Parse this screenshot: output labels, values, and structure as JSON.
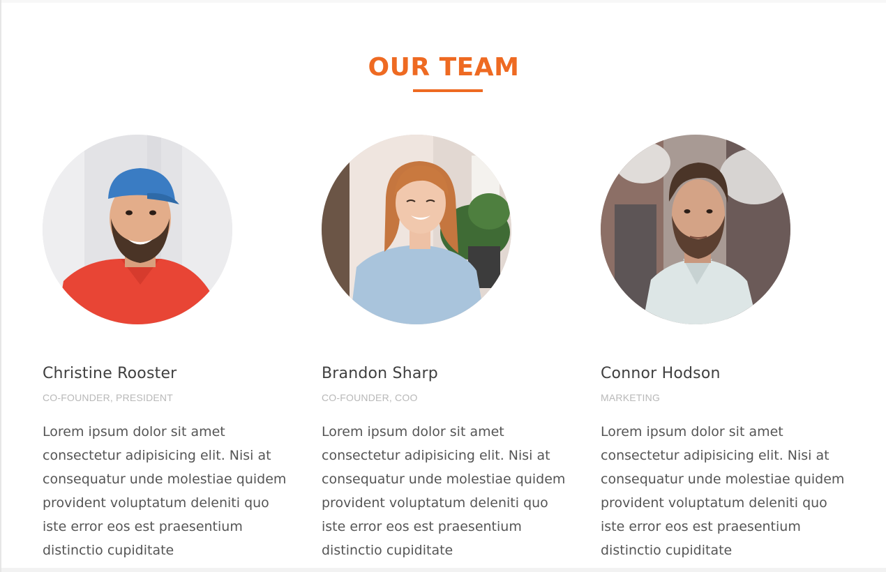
{
  "section": {
    "title": "OUR TEAM",
    "accent_color": "#ee6a22"
  },
  "members": [
    {
      "name": "Christine Rooster",
      "role": "CO-FOUNDER, PRESIDENT",
      "bio": "Lorem ipsum dolor sit amet consectetur adipisicing elit. Nisi at consequatur unde molestiae quidem provident voluptatum deleniti quo iste error eos est praesentium distinctio cupiditate"
    },
    {
      "name": "Brandon Sharp",
      "role": "CO-FOUNDER, COO",
      "bio": "Lorem ipsum dolor sit amet consectetur adipisicing elit. Nisi at consequatur unde molestiae quidem provident voluptatum deleniti quo iste error eos est praesentium distinctio cupiditate"
    },
    {
      "name": "Connor Hodson",
      "role": "MARKETING",
      "bio": "Lorem ipsum dolor sit amet consectetur adipisicing elit. Nisi at consequatur unde molestiae quidem provident voluptatum deleniti quo iste error eos est praesentium distinctio cupiditate"
    }
  ]
}
